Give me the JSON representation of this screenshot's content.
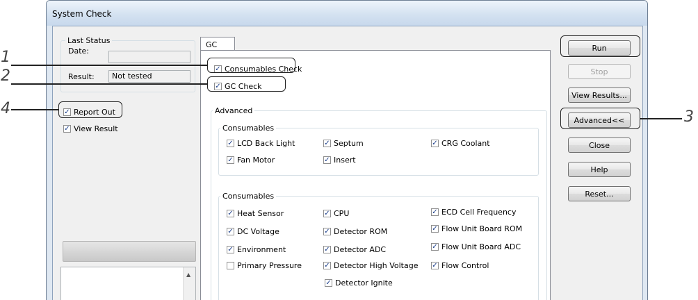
{
  "window": {
    "title": "System Check"
  },
  "last_status": {
    "legend": "Last Status",
    "date_label": "Date:",
    "date_value": "",
    "result_label": "Result:",
    "result_value": "Not tested"
  },
  "left_options": [
    {
      "label": "Report Out",
      "checked": true
    },
    {
      "label": "View Result",
      "checked": true
    }
  ],
  "tab": {
    "label": "GC"
  },
  "checks": {
    "consumables_check": {
      "label": "Consumables Check",
      "checked": true
    },
    "gc_check": {
      "label": "GC Check",
      "checked": true
    }
  },
  "advanced": {
    "legend": "Advanced",
    "group1": {
      "legend": "Consumables",
      "items": [
        {
          "label": "LCD Back Light",
          "checked": true
        },
        {
          "label": "Septum",
          "checked": true
        },
        {
          "label": "CRG Coolant",
          "checked": true
        },
        {
          "label": "Fan Motor",
          "checked": true
        },
        {
          "label": "Insert",
          "checked": true
        }
      ]
    },
    "group2": {
      "legend": "Consumables",
      "items": [
        {
          "label": "Heat Sensor",
          "checked": true
        },
        {
          "label": "CPU",
          "checked": true
        },
        {
          "label": "ECD Cell Frequency",
          "checked": true
        },
        {
          "label": "DC Voltage",
          "checked": true
        },
        {
          "label": "Detector ROM",
          "checked": true
        },
        {
          "label": "Flow Unit Board ROM",
          "checked": true
        },
        {
          "label": "Environment",
          "checked": true
        },
        {
          "label": "Detector ADC",
          "checked": true
        },
        {
          "label": "Flow Unit Board ADC",
          "checked": true
        },
        {
          "label": "Primary Pressure",
          "checked": false
        },
        {
          "label": "Detector High Voltage",
          "checked": true
        },
        {
          "label": "Flow Control",
          "checked": true
        },
        {
          "label": "Detector Ignite",
          "checked": true
        }
      ]
    }
  },
  "buttons": {
    "run": "Run",
    "stop": "Stop",
    "view_results": "View Results...",
    "advanced": "Advanced<<",
    "close": "Close",
    "help": "Help",
    "reset": "Reset..."
  },
  "callouts": [
    "1",
    "2",
    "3",
    "4"
  ]
}
